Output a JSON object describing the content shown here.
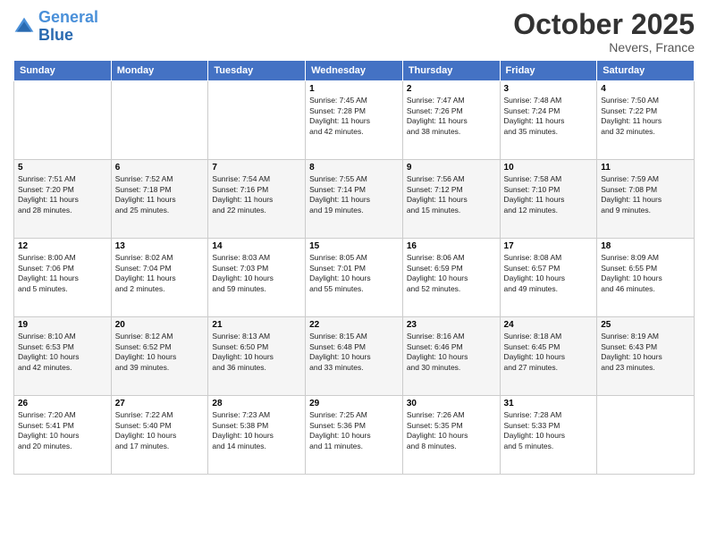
{
  "logo": {
    "line1": "General",
    "line2": "Blue"
  },
  "title": "October 2025",
  "location": "Nevers, France",
  "days_header": [
    "Sunday",
    "Monday",
    "Tuesday",
    "Wednesday",
    "Thursday",
    "Friday",
    "Saturday"
  ],
  "weeks": [
    [
      {
        "day": "",
        "info": ""
      },
      {
        "day": "",
        "info": ""
      },
      {
        "day": "",
        "info": ""
      },
      {
        "day": "1",
        "info": "Sunrise: 7:45 AM\nSunset: 7:28 PM\nDaylight: 11 hours\nand 42 minutes."
      },
      {
        "day": "2",
        "info": "Sunrise: 7:47 AM\nSunset: 7:26 PM\nDaylight: 11 hours\nand 38 minutes."
      },
      {
        "day": "3",
        "info": "Sunrise: 7:48 AM\nSunset: 7:24 PM\nDaylight: 11 hours\nand 35 minutes."
      },
      {
        "day": "4",
        "info": "Sunrise: 7:50 AM\nSunset: 7:22 PM\nDaylight: 11 hours\nand 32 minutes."
      }
    ],
    [
      {
        "day": "5",
        "info": "Sunrise: 7:51 AM\nSunset: 7:20 PM\nDaylight: 11 hours\nand 28 minutes."
      },
      {
        "day": "6",
        "info": "Sunrise: 7:52 AM\nSunset: 7:18 PM\nDaylight: 11 hours\nand 25 minutes."
      },
      {
        "day": "7",
        "info": "Sunrise: 7:54 AM\nSunset: 7:16 PM\nDaylight: 11 hours\nand 22 minutes."
      },
      {
        "day": "8",
        "info": "Sunrise: 7:55 AM\nSunset: 7:14 PM\nDaylight: 11 hours\nand 19 minutes."
      },
      {
        "day": "9",
        "info": "Sunrise: 7:56 AM\nSunset: 7:12 PM\nDaylight: 11 hours\nand 15 minutes."
      },
      {
        "day": "10",
        "info": "Sunrise: 7:58 AM\nSunset: 7:10 PM\nDaylight: 11 hours\nand 12 minutes."
      },
      {
        "day": "11",
        "info": "Sunrise: 7:59 AM\nSunset: 7:08 PM\nDaylight: 11 hours\nand 9 minutes."
      }
    ],
    [
      {
        "day": "12",
        "info": "Sunrise: 8:00 AM\nSunset: 7:06 PM\nDaylight: 11 hours\nand 5 minutes."
      },
      {
        "day": "13",
        "info": "Sunrise: 8:02 AM\nSunset: 7:04 PM\nDaylight: 11 hours\nand 2 minutes."
      },
      {
        "day": "14",
        "info": "Sunrise: 8:03 AM\nSunset: 7:03 PM\nDaylight: 10 hours\nand 59 minutes."
      },
      {
        "day": "15",
        "info": "Sunrise: 8:05 AM\nSunset: 7:01 PM\nDaylight: 10 hours\nand 55 minutes."
      },
      {
        "day": "16",
        "info": "Sunrise: 8:06 AM\nSunset: 6:59 PM\nDaylight: 10 hours\nand 52 minutes."
      },
      {
        "day": "17",
        "info": "Sunrise: 8:08 AM\nSunset: 6:57 PM\nDaylight: 10 hours\nand 49 minutes."
      },
      {
        "day": "18",
        "info": "Sunrise: 8:09 AM\nSunset: 6:55 PM\nDaylight: 10 hours\nand 46 minutes."
      }
    ],
    [
      {
        "day": "19",
        "info": "Sunrise: 8:10 AM\nSunset: 6:53 PM\nDaylight: 10 hours\nand 42 minutes."
      },
      {
        "day": "20",
        "info": "Sunrise: 8:12 AM\nSunset: 6:52 PM\nDaylight: 10 hours\nand 39 minutes."
      },
      {
        "day": "21",
        "info": "Sunrise: 8:13 AM\nSunset: 6:50 PM\nDaylight: 10 hours\nand 36 minutes."
      },
      {
        "day": "22",
        "info": "Sunrise: 8:15 AM\nSunset: 6:48 PM\nDaylight: 10 hours\nand 33 minutes."
      },
      {
        "day": "23",
        "info": "Sunrise: 8:16 AM\nSunset: 6:46 PM\nDaylight: 10 hours\nand 30 minutes."
      },
      {
        "day": "24",
        "info": "Sunrise: 8:18 AM\nSunset: 6:45 PM\nDaylight: 10 hours\nand 27 minutes."
      },
      {
        "day": "25",
        "info": "Sunrise: 8:19 AM\nSunset: 6:43 PM\nDaylight: 10 hours\nand 23 minutes."
      }
    ],
    [
      {
        "day": "26",
        "info": "Sunrise: 7:20 AM\nSunset: 5:41 PM\nDaylight: 10 hours\nand 20 minutes."
      },
      {
        "day": "27",
        "info": "Sunrise: 7:22 AM\nSunset: 5:40 PM\nDaylight: 10 hours\nand 17 minutes."
      },
      {
        "day": "28",
        "info": "Sunrise: 7:23 AM\nSunset: 5:38 PM\nDaylight: 10 hours\nand 14 minutes."
      },
      {
        "day": "29",
        "info": "Sunrise: 7:25 AM\nSunset: 5:36 PM\nDaylight: 10 hours\nand 11 minutes."
      },
      {
        "day": "30",
        "info": "Sunrise: 7:26 AM\nSunset: 5:35 PM\nDaylight: 10 hours\nand 8 minutes."
      },
      {
        "day": "31",
        "info": "Sunrise: 7:28 AM\nSunset: 5:33 PM\nDaylight: 10 hours\nand 5 minutes."
      },
      {
        "day": "",
        "info": ""
      }
    ]
  ]
}
